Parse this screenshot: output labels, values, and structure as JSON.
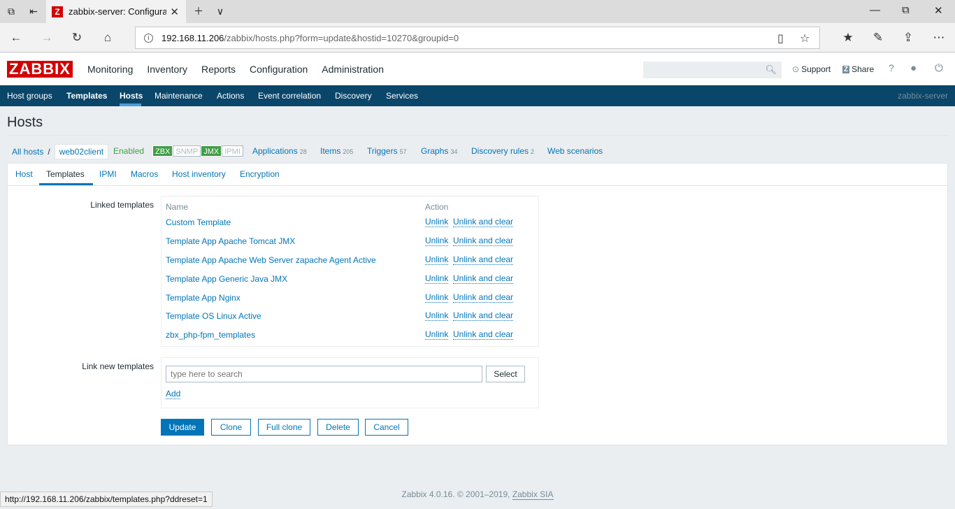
{
  "browser": {
    "tab_title": "zabbix-server: Configura",
    "url_host": "192.168.11.206",
    "url_path": "/zabbix/hosts.php?form=update&hostid=10270&groupid=0",
    "status_url": "http://192.168.11.206/zabbix/templates.php?ddreset=1"
  },
  "header": {
    "logo": "ZABBIX",
    "menu": [
      "Monitoring",
      "Inventory",
      "Reports",
      "Configuration",
      "Administration"
    ],
    "support": "Support",
    "share": "Share",
    "help": "?"
  },
  "submenu": {
    "items": [
      "Host groups",
      "Templates",
      "Hosts",
      "Maintenance",
      "Actions",
      "Event correlation",
      "Discovery",
      "Services"
    ],
    "server_name": "zabbix-server"
  },
  "page": {
    "title": "Hosts",
    "breadcrumb_all": "All hosts",
    "breadcrumb_sep": "/",
    "breadcrumb_current": "web02client",
    "status": "Enabled",
    "availability": [
      "ZBX",
      "SNMP",
      "JMX",
      "IPMI"
    ],
    "links": [
      {
        "label": "Applications",
        "count": "28"
      },
      {
        "label": "Items",
        "count": "205"
      },
      {
        "label": "Triggers",
        "count": "57"
      },
      {
        "label": "Graphs",
        "count": "34"
      },
      {
        "label": "Discovery rules",
        "count": "2"
      },
      {
        "label": "Web scenarios",
        "count": ""
      }
    ]
  },
  "tabs": [
    "Host",
    "Templates",
    "IPMI",
    "Macros",
    "Host inventory",
    "Encryption"
  ],
  "form": {
    "linked_label": "Linked templates",
    "col_name": "Name",
    "col_action": "Action",
    "unlink": "Unlink",
    "unlink_clear": "Unlink and clear",
    "templates": [
      "Custom Template",
      "Template App Apache Tomcat JMX",
      "Template App Apache Web Server zapache Agent Active",
      "Template App Generic Java JMX",
      "Template App Nginx",
      "Template OS Linux Active",
      "zbx_php-fpm_templates"
    ],
    "new_label": "Link new templates",
    "search_placeholder": "type here to search",
    "select_btn": "Select",
    "add_link": "Add",
    "buttons": [
      "Update",
      "Clone",
      "Full clone",
      "Delete",
      "Cancel"
    ]
  },
  "footer": {
    "text": "Zabbix 4.0.16. © 2001–2019, ",
    "company": "Zabbix SIA"
  }
}
